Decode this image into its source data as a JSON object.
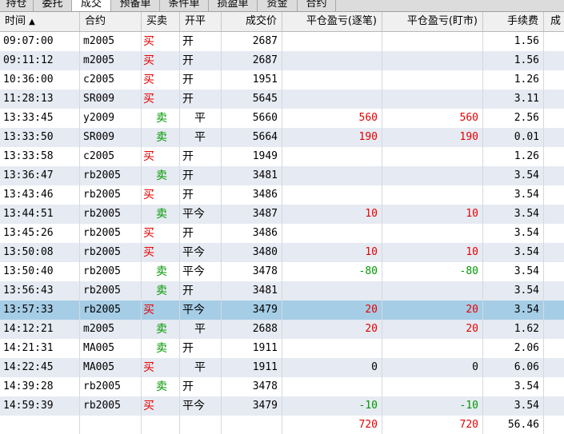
{
  "tabs": [
    "持仓",
    "委托",
    "成交",
    "预备单",
    "条件单",
    "损盈单",
    "资金",
    "合约"
  ],
  "active_tab": 2,
  "columns": {
    "time": "时间",
    "sort_indicator": "▲",
    "contract": "合约",
    "side": "买卖",
    "offset": "开平",
    "price": "成交价",
    "pnl_trade": "平仓盈亏(逐笔)",
    "pnl_mark": "平仓盈亏(盯市)",
    "fee": "手续费",
    "extra": "成"
  },
  "colors": {
    "buy": "#e60000",
    "sell": "#009900",
    "selected_row": "#a6cde6",
    "alt_row": "#e6eaf2"
  },
  "trades": [
    {
      "time": "09:07:00",
      "contract": "m2005",
      "side": "买",
      "offset": "开",
      "price": "2687",
      "pnl_trade": "",
      "pnl_mark": "",
      "fee": "1.56"
    },
    {
      "time": "09:11:12",
      "contract": "m2005",
      "side": "买",
      "offset": "开",
      "price": "2687",
      "pnl_trade": "",
      "pnl_mark": "",
      "fee": "1.56"
    },
    {
      "time": "10:36:00",
      "contract": "c2005",
      "side": "买",
      "offset": "开",
      "price": "1951",
      "pnl_trade": "",
      "pnl_mark": "",
      "fee": "1.26"
    },
    {
      "time": "11:28:13",
      "contract": "SR009",
      "side": "买",
      "offset": "开",
      "price": "5645",
      "pnl_trade": "",
      "pnl_mark": "",
      "fee": "3.11"
    },
    {
      "time": "13:33:45",
      "contract": "y2009",
      "side": "卖",
      "offset": "平",
      "price": "5660",
      "pnl_trade": "560",
      "pnl_mark": "560",
      "fee": "2.56"
    },
    {
      "time": "13:33:50",
      "contract": "SR009",
      "side": "卖",
      "offset": "平",
      "price": "5664",
      "pnl_trade": "190",
      "pnl_mark": "190",
      "fee": "0.01"
    },
    {
      "time": "13:33:58",
      "contract": "c2005",
      "side": "买",
      "offset": "开",
      "price": "1949",
      "pnl_trade": "",
      "pnl_mark": "",
      "fee": "1.26"
    },
    {
      "time": "13:36:47",
      "contract": "rb2005",
      "side": "卖",
      "offset": "开",
      "price": "3481",
      "pnl_trade": "",
      "pnl_mark": "",
      "fee": "3.54"
    },
    {
      "time": "13:43:46",
      "contract": "rb2005",
      "side": "买",
      "offset": "开",
      "price": "3486",
      "pnl_trade": "",
      "pnl_mark": "",
      "fee": "3.54"
    },
    {
      "time": "13:44:51",
      "contract": "rb2005",
      "side": "卖",
      "offset": "平今",
      "price": "3487",
      "pnl_trade": "10",
      "pnl_mark": "10",
      "fee": "3.54"
    },
    {
      "time": "13:45:26",
      "contract": "rb2005",
      "side": "买",
      "offset": "开",
      "price": "3486",
      "pnl_trade": "",
      "pnl_mark": "",
      "fee": "3.54"
    },
    {
      "time": "13:50:08",
      "contract": "rb2005",
      "side": "买",
      "offset": "平今",
      "price": "3480",
      "pnl_trade": "10",
      "pnl_mark": "10",
      "fee": "3.54"
    },
    {
      "time": "13:50:40",
      "contract": "rb2005",
      "side": "卖",
      "offset": "平今",
      "price": "3478",
      "pnl_trade": "-80",
      "pnl_mark": "-80",
      "fee": "3.54"
    },
    {
      "time": "13:56:43",
      "contract": "rb2005",
      "side": "卖",
      "offset": "开",
      "price": "3481",
      "pnl_trade": "",
      "pnl_mark": "",
      "fee": "3.54"
    },
    {
      "time": "13:57:33",
      "contract": "rb2005",
      "side": "买",
      "offset": "平今",
      "price": "3479",
      "pnl_trade": "20",
      "pnl_mark": "20",
      "fee": "3.54",
      "selected": true
    },
    {
      "time": "14:12:21",
      "contract": "m2005",
      "side": "卖",
      "offset": "平",
      "price": "2688",
      "pnl_trade": "20",
      "pnl_mark": "20",
      "fee": "1.62"
    },
    {
      "time": "14:21:31",
      "contract": "MA005",
      "side": "卖",
      "offset": "开",
      "price": "1911",
      "pnl_trade": "",
      "pnl_mark": "",
      "fee": "2.06"
    },
    {
      "time": "14:22:45",
      "contract": "MA005",
      "side": "买",
      "offset": "平",
      "price": "1911",
      "pnl_trade": "0",
      "pnl_mark": "0",
      "fee": "6.06"
    },
    {
      "time": "14:39:28",
      "contract": "rb2005",
      "side": "卖",
      "offset": "开",
      "price": "3478",
      "pnl_trade": "",
      "pnl_mark": "",
      "fee": "3.54"
    },
    {
      "time": "14:59:39",
      "contract": "rb2005",
      "side": "买",
      "offset": "平今",
      "price": "3479",
      "pnl_trade": "-10",
      "pnl_mark": "-10",
      "fee": "3.54"
    }
  ],
  "totals": {
    "pnl_trade": "720",
    "pnl_mark": "720",
    "fee": "56.46"
  }
}
